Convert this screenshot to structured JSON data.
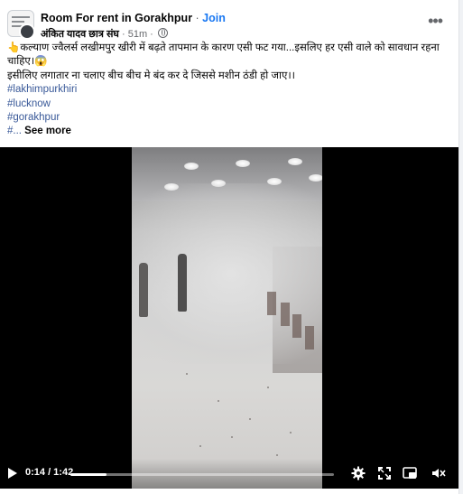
{
  "post": {
    "group_name": "Room For rent in Gorakhpur",
    "separator": " · ",
    "join_label": "Join",
    "author": "अंकित यादव छात्र संघ",
    "time": "51m",
    "more_icon": "more-horizontal-icon",
    "text_line1": "👆कल्याण ज्वैलर्स लखीमपुर खीरी में बढ़ते तापमान के कारण एसी फट गया...इसलिए हर एसी वाले को सावधान रहना चाहिए।😱",
    "text_line2": "इसीलिए लगातार ना चलाए  बीच बीच मे बंद कर दे जिससे मशीन ठंडी हो जाए।।",
    "hashtags": [
      "#lakhimpurkhiri",
      "#lucknow",
      "#gorakhpur"
    ],
    "truncated_prefix": "#...",
    "see_more_label": " See more"
  },
  "video": {
    "time_current": "0:14",
    "time_total": "1:42",
    "time_display": "0:14 / 1:42",
    "progress": 0.137,
    "icons": [
      "play-icon",
      "settings-gear-icon",
      "fullscreen-icon",
      "picture-in-picture-icon",
      "volume-muted-icon"
    ]
  },
  "colors": {
    "link_blue": "#1877f2",
    "hashtag_blue": "#385898",
    "secondary_text": "#65676b"
  }
}
